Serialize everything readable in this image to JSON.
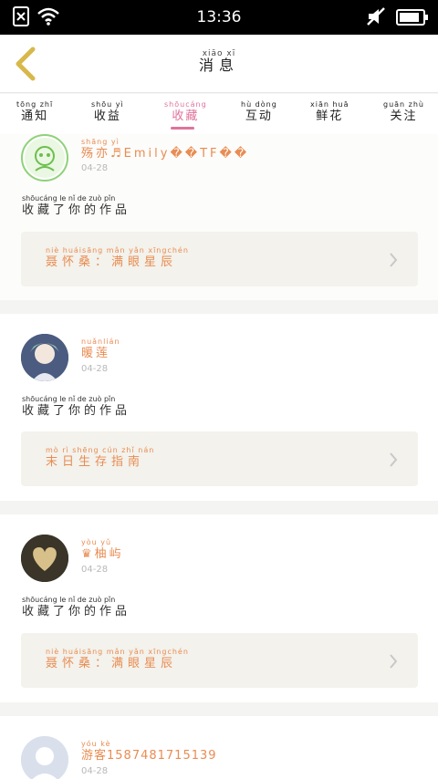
{
  "status_bar": {
    "time": "13:36",
    "icons": [
      "sim-missing-icon",
      "wifi-icon",
      "mute-icon",
      "battery-icon"
    ]
  },
  "header": {
    "back_icon": "chevron-left-icon",
    "title_pinyin": "xiāo  xī",
    "title": "消息"
  },
  "tabs": [
    {
      "pinyin": "tōng zhī",
      "label": "通知"
    },
    {
      "pinyin": "shōu yì",
      "label": "收益"
    },
    {
      "pinyin": "shōucáng",
      "label": "收藏",
      "active": true
    },
    {
      "pinyin": "hù dòng",
      "label": "互动"
    },
    {
      "pinyin": "xiān huā",
      "label": "鲜花"
    },
    {
      "pinyin": "guān zhù",
      "label": "关注"
    }
  ],
  "accent_color": "#e0729c",
  "name_color": "#e98c52",
  "items": [
    {
      "name_pinyin": "shāng yì",
      "name": "殇亦♬Emily��TF��",
      "date": "04-28",
      "action_pinyin": "shōucáng  le   nǐ   de  zuò  pǐn",
      "action": "收藏了你的作品",
      "work_pinyin": "niè huáisāng     mǎn yǎn xīngchén",
      "work": "聂怀桑：满眼星辰"
    },
    {
      "name_pinyin": "nuǎnlián",
      "name": "暖莲",
      "date": "04-28",
      "action_pinyin": "shōucáng  le   nǐ   de  zuò  pǐn",
      "action": "收藏了你的作品",
      "work_pinyin": "mò  rì  shēng cún  zhǐ  nán",
      "work": "末日生存指南"
    },
    {
      "name_pinyin": "yòu  yǔ",
      "name": "♛柚屿",
      "date": "04-28",
      "action_pinyin": "shōucáng  le   nǐ   de  zuò  pǐn",
      "action": "收藏了你的作品",
      "work_pinyin": "niè huáisāng     mǎn yǎn xīngchén",
      "work": "聂怀桑：满眼星辰"
    },
    {
      "name_pinyin": "yóu  kè",
      "name": "游客1587481715139",
      "date": "04-28"
    }
  ]
}
